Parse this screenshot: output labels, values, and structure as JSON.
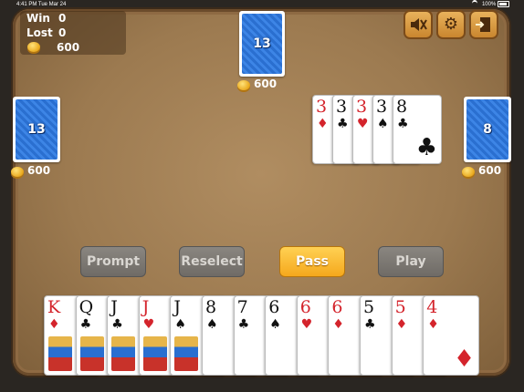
{
  "status_bar": {
    "time": "4:41 PM   Tue Mar 24",
    "battery": "100%"
  },
  "score": {
    "win_label": "Win",
    "win_value": "0",
    "lost_label": "Lost",
    "lost_value": "0",
    "coins": "600"
  },
  "opponents": {
    "top": {
      "cards_left": "13",
      "coins": "600"
    },
    "left": {
      "cards_left": "13",
      "coins": "600"
    },
    "right": {
      "cards_left": "8",
      "coins": "600"
    }
  },
  "played_cards": [
    {
      "rank": "3",
      "suit": "♦",
      "color": "red"
    },
    {
      "rank": "3",
      "suit": "♣",
      "color": "black"
    },
    {
      "rank": "3",
      "suit": "♥",
      "color": "red"
    },
    {
      "rank": "3",
      "suit": "♠",
      "color": "black"
    },
    {
      "rank": "8",
      "suit": "♣",
      "color": "black"
    }
  ],
  "hand": [
    {
      "rank": "K",
      "suit": "♦",
      "color": "red"
    },
    {
      "rank": "Q",
      "suit": "♣",
      "color": "black"
    },
    {
      "rank": "J",
      "suit": "♣",
      "color": "black"
    },
    {
      "rank": "J",
      "suit": "♥",
      "color": "red"
    },
    {
      "rank": "J",
      "suit": "♠",
      "color": "black"
    },
    {
      "rank": "8",
      "suit": "♠",
      "color": "black"
    },
    {
      "rank": "7",
      "suit": "♣",
      "color": "black"
    },
    {
      "rank": "6",
      "suit": "♠",
      "color": "black"
    },
    {
      "rank": "6",
      "suit": "♥",
      "color": "red"
    },
    {
      "rank": "6",
      "suit": "♦",
      "color": "red"
    },
    {
      "rank": "5",
      "suit": "♣",
      "color": "black"
    },
    {
      "rank": "5",
      "suit": "♦",
      "color": "red"
    },
    {
      "rank": "4",
      "suit": "♦",
      "color": "red"
    }
  ],
  "buttons": {
    "prompt": "Prompt",
    "reselect": "Reselect",
    "pass": "Pass",
    "play": "Play"
  },
  "top_controls": {
    "mute_icon": "speaker-muted-icon",
    "settings_icon": "gear-icon",
    "exit_icon": "exit-door-icon"
  },
  "colors": {
    "red_suit": "#d4242c",
    "card_back": "#2a6fd0",
    "pass_button": "#f5a81c",
    "felt": "#9c7a50"
  }
}
